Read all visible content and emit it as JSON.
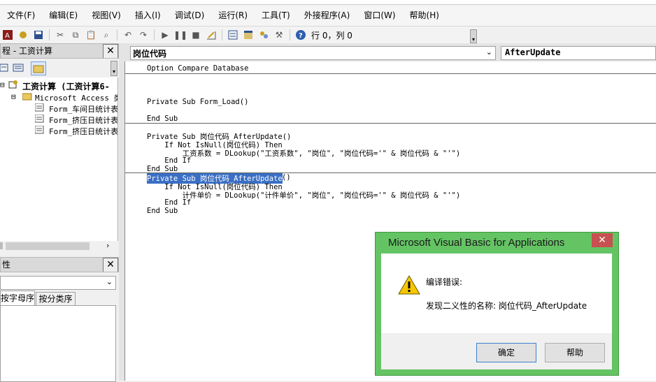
{
  "menubar": {
    "items": [
      "文件(F)",
      "编辑(E)",
      "视图(V)",
      "插入(I)",
      "调试(D)",
      "运行(R)",
      "工具(T)",
      "外接程序(A)",
      "窗口(W)",
      "帮助(H)"
    ]
  },
  "toolbar": {
    "row_col": "行 0，列 0"
  },
  "project_panel": {
    "title": "程 - 工资计算",
    "root": "工资计算 (工资计算6-",
    "folder": "Microsoft Access 类",
    "items": [
      "Form_车间日统计表",
      "Form_挤压日统计表",
      "Form_挤压日统计表"
    ]
  },
  "properties_panel": {
    "title": "性",
    "tab_alpha": "按字母序",
    "tab_category": "按分类序"
  },
  "code_window": {
    "object_dropdown": "岗位代码",
    "procedure_dropdown": "AfterUpdate",
    "lines": [
      "Option Compare Database",
      "Private Sub Form_Load()",
      "End Sub",
      "Private Sub 岗位代码_AfterUpdate()",
      "    If Not IsNull(岗位代码) Then",
      "        工资系数 = DLookup(\"工资系数\", \"岗位\", \"岗位代码='\" & 岗位代码 & \"'\")",
      "    End If",
      "End Sub",
      "Private Sub 岗位代码_AfterUpdate",
      "()",
      "    If Not IsNull(岗位代码) Then",
      "        计件单价 = DLookup(\"计件单价\", \"岗位\", \"岗位代码='\" & 岗位代码 & \"'\")",
      "    End If",
      "End Sub"
    ]
  },
  "dialog": {
    "title": "Microsoft Visual Basic for Applications",
    "heading": "编译错误:",
    "message": "发现二义性的名称: 岗位代码_AfterUpdate",
    "ok_label": "确定",
    "help_label": "帮助"
  },
  "colors": {
    "dialog_frame": "#64c464",
    "dialog_close": "#c75050",
    "selection": "#3a6fc4"
  }
}
